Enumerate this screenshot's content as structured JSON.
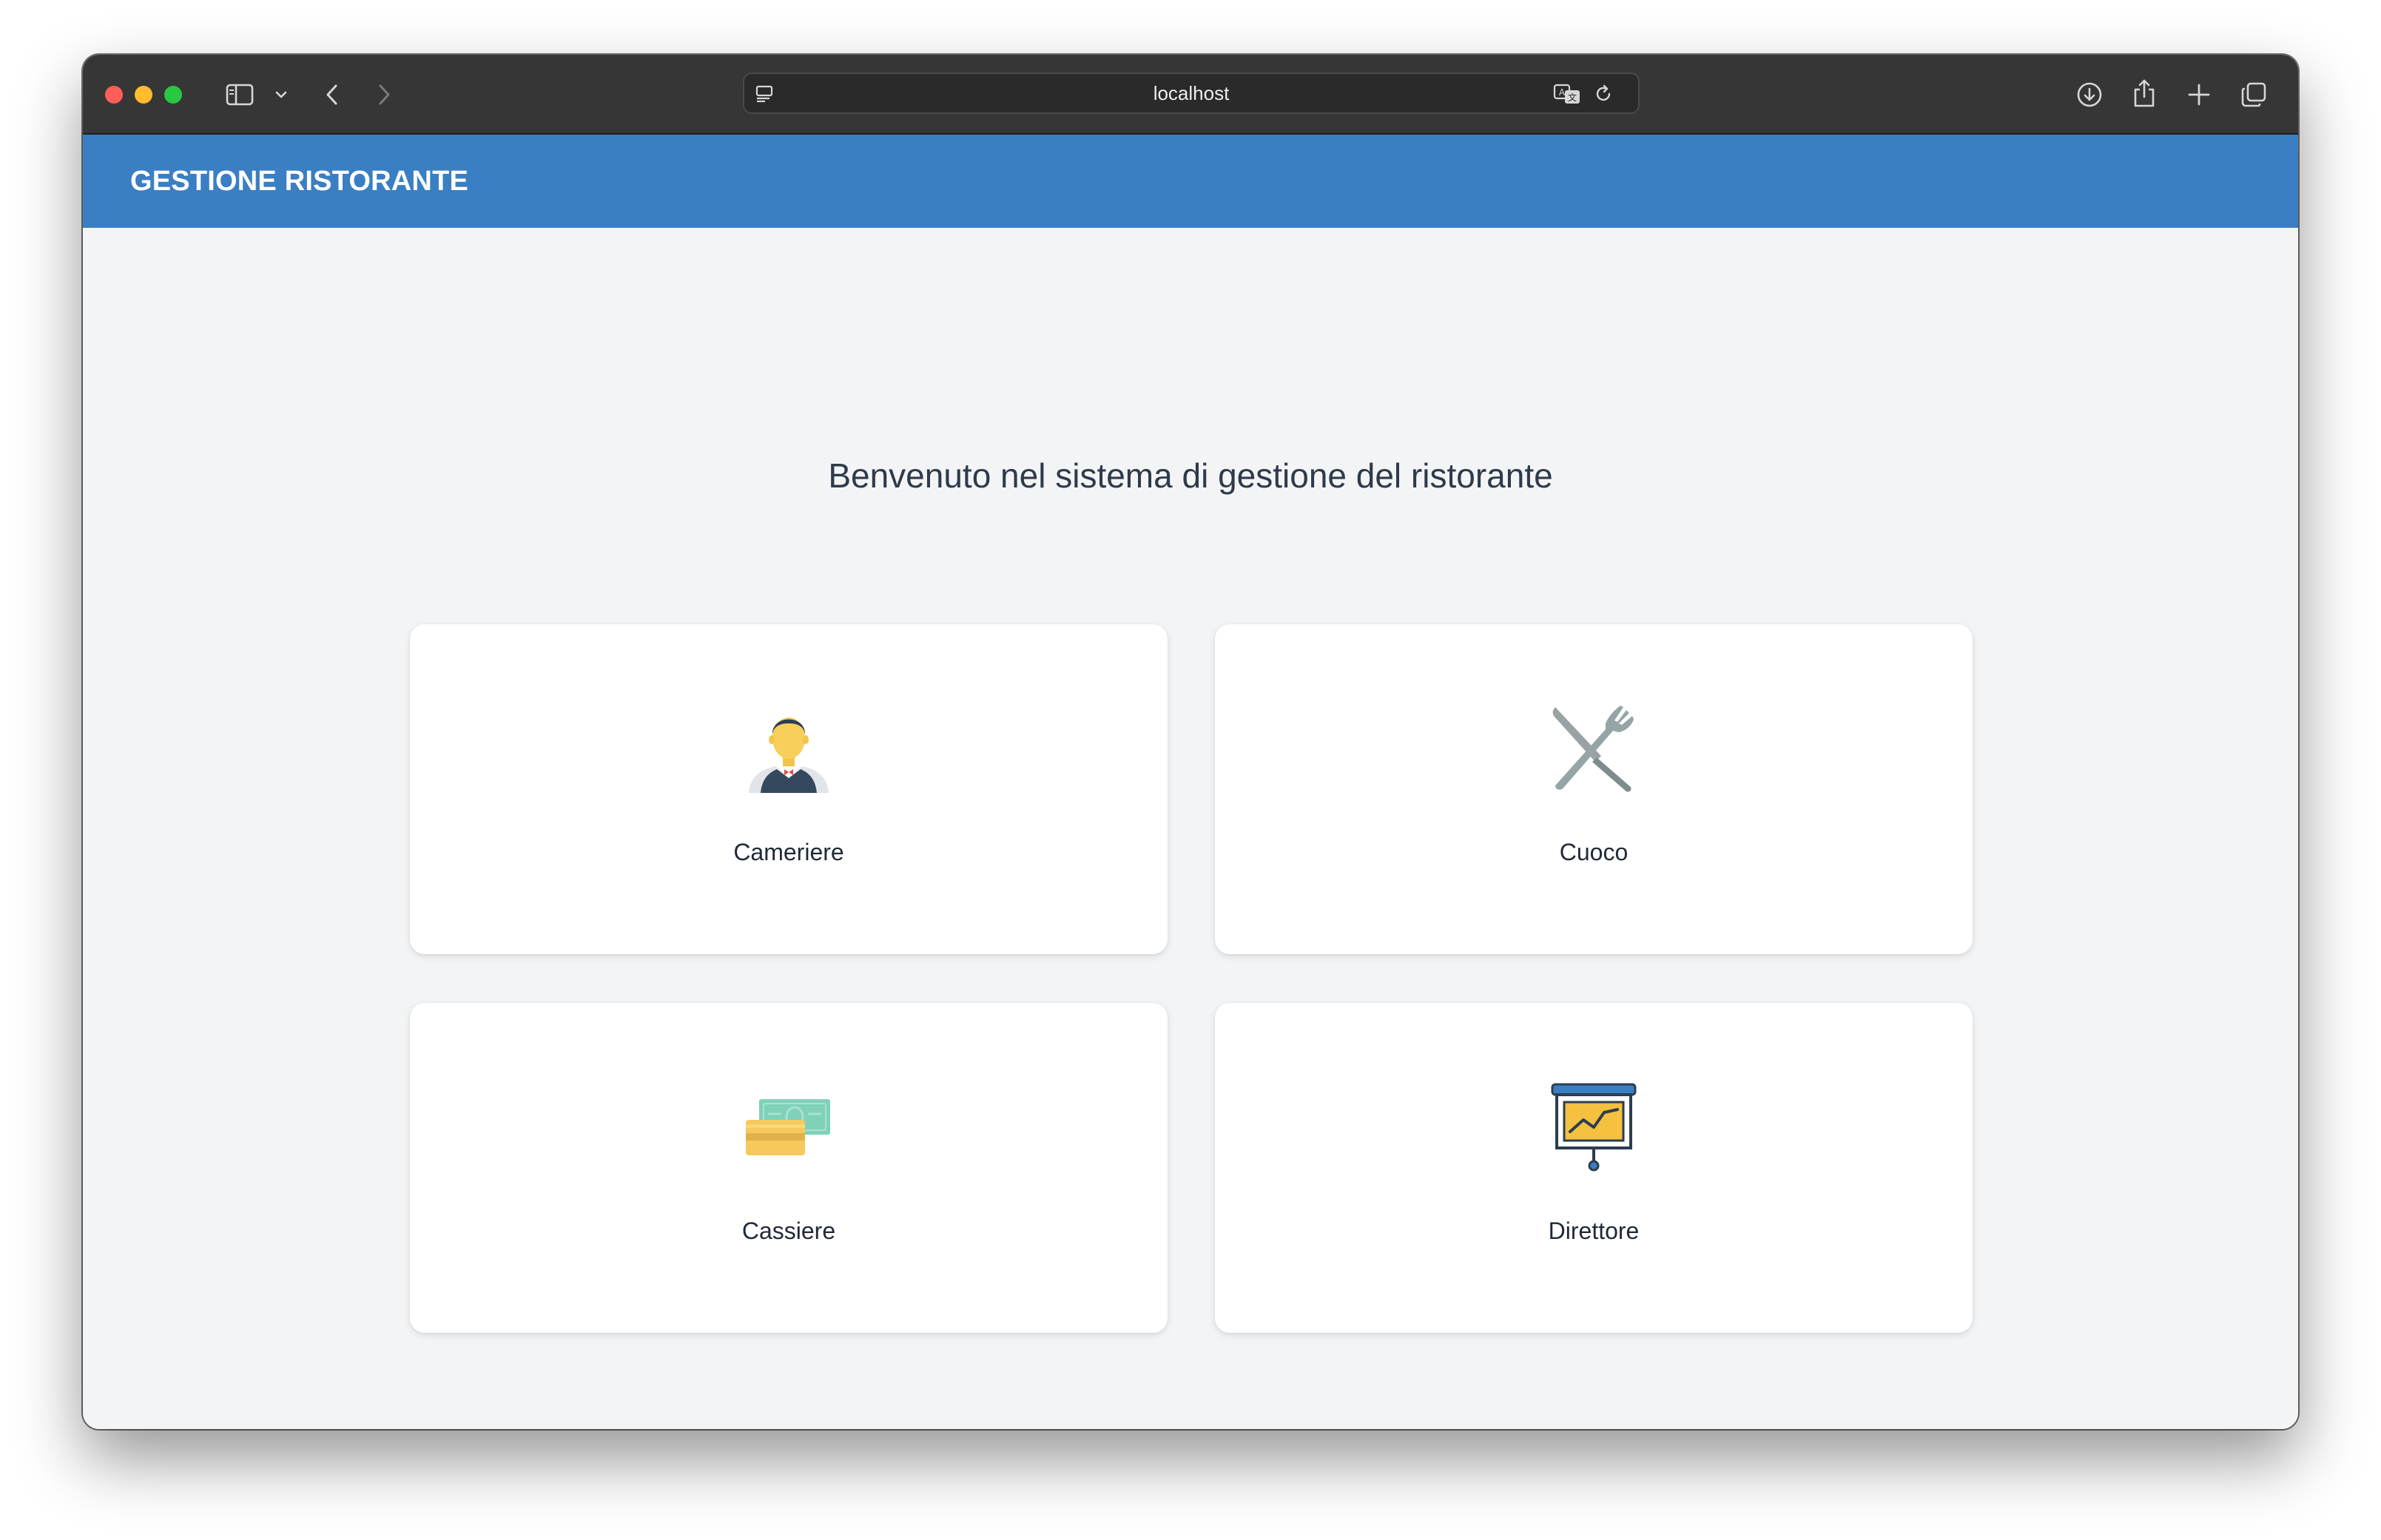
{
  "browser": {
    "url": "localhost",
    "icons": {
      "sidebar": "sidebar-icon",
      "sidebar_menu": "chevron-down-icon",
      "back": "back-arrow-icon",
      "forward": "forward-arrow-icon",
      "page_settings": "page-settings-icon",
      "translate": "translate-icon",
      "reload": "reload-icon",
      "downloads": "download-icon",
      "share": "share-icon",
      "new_tab": "plus-icon",
      "tabs_overview": "tabs-overview-icon"
    }
  },
  "header": {
    "brand": "GESTIONE RISTORANTE",
    "color": "#3a7fc4"
  },
  "main": {
    "welcome": "Benvenuto nel sistema di gestione del ristorante"
  },
  "roles": [
    {
      "label": "Cameriere",
      "icon": "waiter-icon"
    },
    {
      "label": "Cuoco",
      "icon": "cutlery-icon"
    },
    {
      "label": "Cassiere",
      "icon": "money-card-icon"
    },
    {
      "label": "Direttore",
      "icon": "presentation-chart-icon"
    }
  ]
}
